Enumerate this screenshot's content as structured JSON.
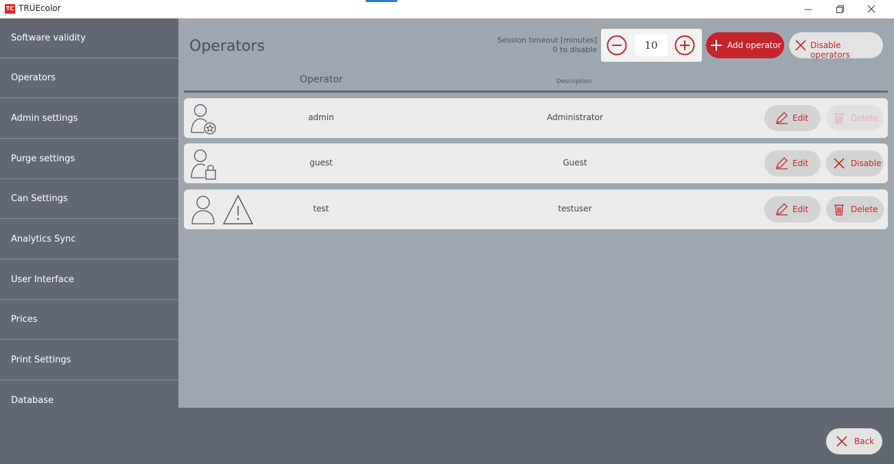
{
  "window": {
    "logo_text": "TC",
    "title": "TRUEcolor",
    "controls": [
      "minimize-icon",
      "maximize-icon",
      "close-icon"
    ]
  },
  "sidebar": {
    "items": [
      {
        "label": "Software validity"
      },
      {
        "label": "Operators"
      },
      {
        "label": "Admin settings"
      },
      {
        "label": "Purge settings"
      },
      {
        "label": "Can Settings"
      },
      {
        "label": "Analytics Sync"
      },
      {
        "label": "User Interface"
      },
      {
        "label": "Prices"
      },
      {
        "label": "Print Settings"
      },
      {
        "label": "Database"
      }
    ]
  },
  "main": {
    "title": "Operators",
    "session_timeout": {
      "label_line1": "Session timeout [minutes]",
      "label_line2": "0 to disable",
      "value": "10"
    },
    "add_operator_label": "Add operator",
    "disable_operators_label": "Disable operators",
    "columns": {
      "operator": "Operator",
      "description": "Description"
    },
    "rows": [
      {
        "name": "admin",
        "description": "Administrator",
        "icon": "user-star-icon",
        "edit_label": "Edit",
        "action_label": "Delete",
        "action_icon": "trash-icon",
        "action_enabled": false
      },
      {
        "name": "guest",
        "description": "Guest",
        "icon": "user-lock-icon",
        "edit_label": "Edit",
        "action_label": "Disable",
        "action_icon": "x-icon",
        "action_enabled": true
      },
      {
        "name": "test",
        "description": "testuser",
        "icon": "user-warning-icon",
        "edit_label": "Edit",
        "action_label": "Delete",
        "action_icon": "trash-icon",
        "action_enabled": true
      }
    ]
  },
  "footer": {
    "back_label": "Back"
  },
  "colors": {
    "accent_red": "#c5242c",
    "sidebar_bg": "#626872",
    "main_bg": "#9ea7ae",
    "row_bg": "#ebebeb"
  }
}
